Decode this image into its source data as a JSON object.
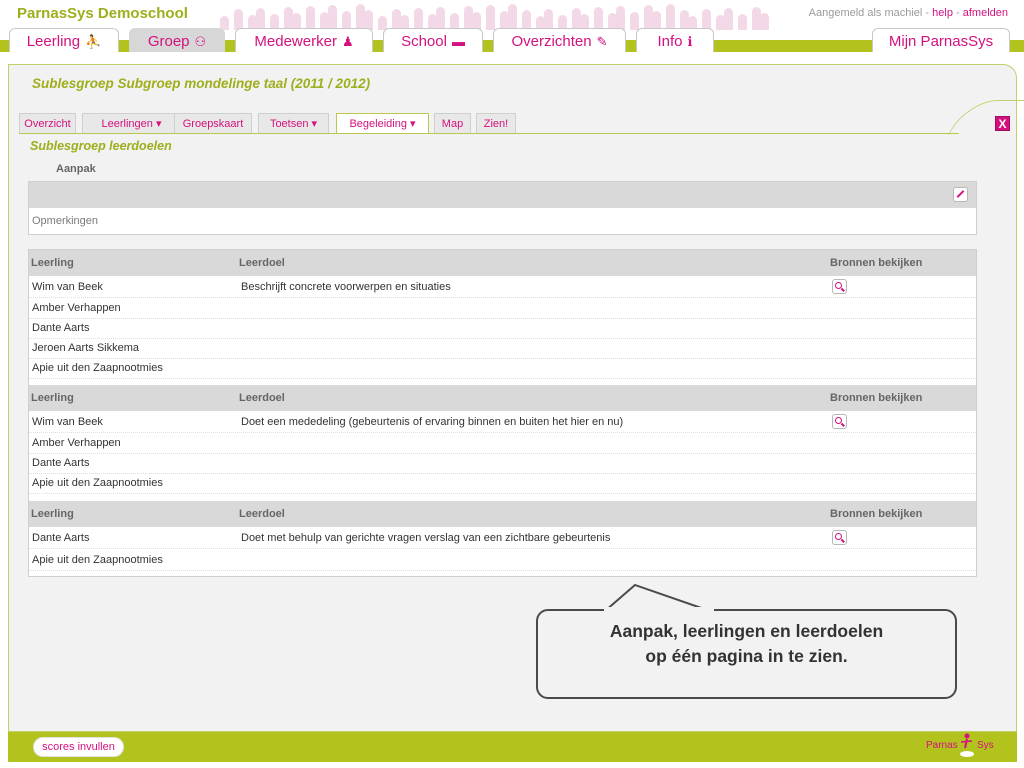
{
  "header": {
    "school_name": "ParnasSys Demoschool",
    "login_prefix": "Aangemeld als machiel - ",
    "help_link": "help",
    "separator": " - ",
    "logout_link": "afmelden"
  },
  "main_tabs": [
    {
      "label": "Leerling",
      "icon": "person-run-icon",
      "glyph": "⛹"
    },
    {
      "label": "Groep",
      "icon": "group-icon",
      "glyph": "⚇"
    },
    {
      "label": "Medewerker",
      "icon": "person-icon",
      "glyph": "♟"
    },
    {
      "label": "School",
      "icon": "school-icon",
      "glyph": "▬"
    },
    {
      "label": "Overzichten",
      "icon": "paperclip-icon",
      "glyph": "✎"
    },
    {
      "label": "Info",
      "icon": "info-icon",
      "glyph": "ℹ"
    }
  ],
  "mijn_tab": "Mijn ParnasSys",
  "page_heading": "Sublesgroep Subgroep mondelinge taal (2011 / 2012)",
  "subtabs": [
    {
      "label": "Overzicht",
      "dropdown": false
    },
    {
      "label": "Leerlingen",
      "dropdown": true
    },
    {
      "label": "Groepskaart",
      "dropdown": false
    },
    {
      "label": "Toetsen",
      "dropdown": true
    },
    {
      "label": "Begeleiding",
      "dropdown": true
    },
    {
      "label": "Map",
      "dropdown": false
    },
    {
      "label": "Zien!",
      "dropdown": false
    }
  ],
  "close_label": "X",
  "section_title": "Sublesgroep leerdoelen",
  "aanpak_label": "Aanpak",
  "opmerkingen_label": "Opmerkingen",
  "table_headers": {
    "leerling": "Leerling",
    "leerdoel": "Leerdoel",
    "bronnen": "Bronnen bekijken"
  },
  "groups": [
    {
      "leerdoel": "Beschrijft concrete voorwerpen en situaties",
      "students": [
        "Wim van Beek",
        "Amber Verhappen",
        "Dante Aarts",
        "Jeroen Aarts Sikkema",
        "Apie uit den Zaapnootmies"
      ]
    },
    {
      "leerdoel": "Doet een mededeling (gebeurtenis of ervaring binnen en buiten het hier en nu)",
      "students": [
        "Wim van Beek",
        "Amber Verhappen",
        "Dante Aarts",
        "Apie uit den Zaapnootmies"
      ]
    },
    {
      "leerdoel": "Doet met behulp van gerichte vragen verslag van een zichtbare gebeurtenis",
      "students": [
        "Dante Aarts",
        "Apie uit den Zaapnootmies"
      ]
    }
  ],
  "callout": {
    "line1": "Aanpak, leerlingen en leerdoelen",
    "line2": "op één pagina in te zien."
  },
  "footer": {
    "scores_button": "scores invullen",
    "logo_left": "Parnas",
    "logo_right": "Sys"
  },
  "colors": {
    "accent_green": "#9fae1b",
    "bar_green": "#b3c31e",
    "link_pink": "#d4117f"
  }
}
